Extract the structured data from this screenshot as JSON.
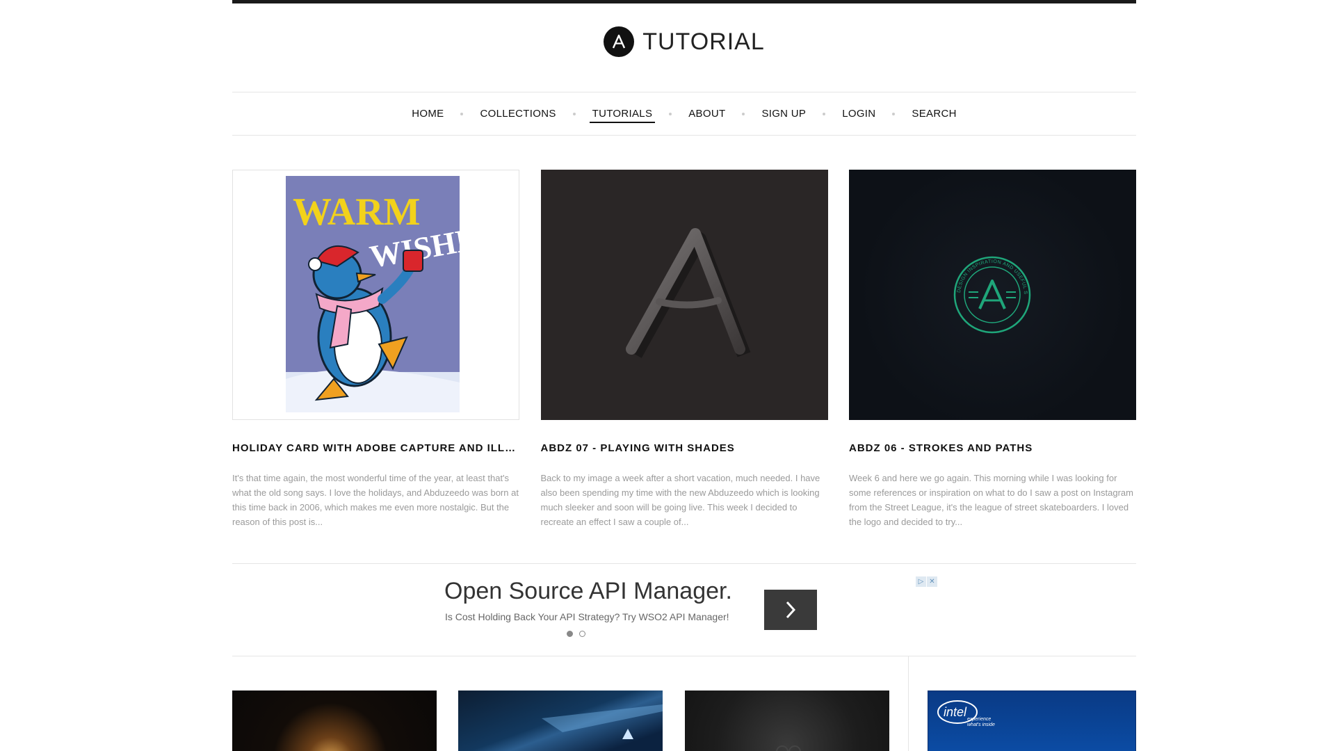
{
  "brand": {
    "logo_letter": "A",
    "name": "TUTORIAL"
  },
  "nav": {
    "items": [
      {
        "label": "HOME",
        "active": false
      },
      {
        "label": "COLLECTIONS",
        "active": false
      },
      {
        "label": "TUTORIALS",
        "active": true
      },
      {
        "label": "ABOUT",
        "active": false
      },
      {
        "label": "SIGN UP",
        "active": false
      },
      {
        "label": "LOGIN",
        "active": false
      },
      {
        "label": "SEARCH",
        "active": false
      }
    ]
  },
  "posts": [
    {
      "title": "HOLIDAY CARD WITH ADOBE CAPTURE AND ILLU...",
      "excerpt": "It's that time again, the most wonderful time of the year, at least that's what the old song says. I love the holidays, and Abduzeedo was born at this time back in 2006, which makes me even more nostalgic. But the reason of this post is...",
      "thumb_text_1": "WARM",
      "thumb_text_2": "WISHES"
    },
    {
      "title": "ABDZ 07 - PLAYING WITH SHADES",
      "excerpt": "Back to my image a week after a short vacation, much needed. I have also been spending my time with the new Abduzeedo which is looking much sleeker and soon will be going live. This week I decided to recreate an effect I saw a couple of..."
    },
    {
      "title": "ABDZ 06 - STROKES AND PATHS",
      "excerpt": "Week 6 and here we go again. This morning while I was looking for some references or inspiration on what to do I saw a post on Instagram from the Street League, it's the league of street skateboarders. I loved the logo and decided to try...",
      "badge_text": "DESIGN INSPIRATION AND USEFUL STUFF"
    }
  ],
  "ad": {
    "headline": "Open Source API Manager.",
    "subline": "Is Cost Holding Back Your API Strategy? Try WSO2 API Manager!",
    "choices_play": "▷",
    "choices_close": "✕"
  },
  "sidebar_ad": {
    "brand": "intel",
    "tagline_1": "experience",
    "tagline_2": "what's inside"
  },
  "colors": {
    "topbar": "#1a1a1a",
    "badge_green": "#1fa67a",
    "intel_blue": "#0b4ea8"
  }
}
